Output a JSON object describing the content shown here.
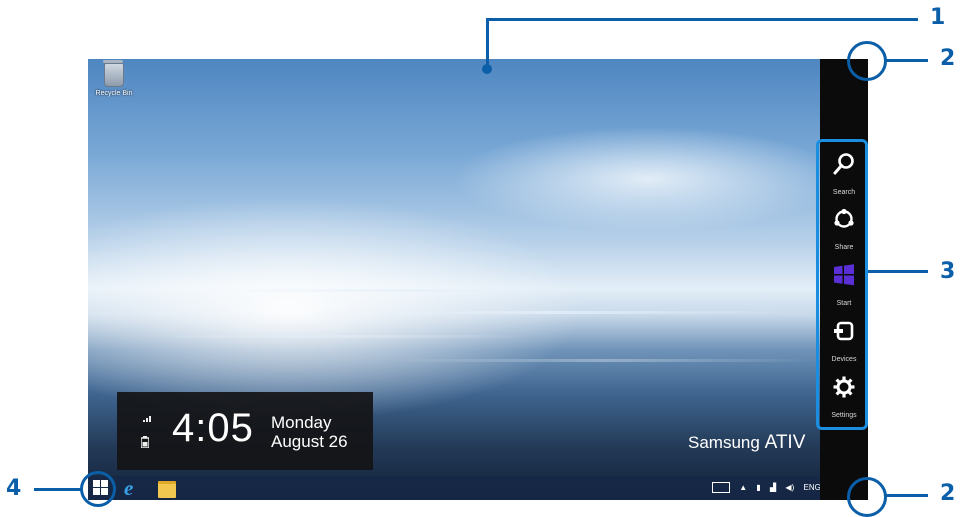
{
  "desktop": {
    "recycle_bin_label": "Recycle Bin",
    "brand_prefix": "Samsung",
    "brand_model": "ATIV"
  },
  "clock": {
    "time": "4:05",
    "day": "Monday",
    "date": "August 26",
    "signal_icon": "signal-icon",
    "battery_icon": "battery-icon"
  },
  "charms": {
    "items": [
      {
        "label": "Search",
        "icon": "search-icon"
      },
      {
        "label": "Share",
        "icon": "share-icon"
      },
      {
        "label": "Start",
        "icon": "windows-logo-icon"
      },
      {
        "label": "Devices",
        "icon": "devices-icon"
      },
      {
        "label": "Settings",
        "icon": "gear-icon"
      }
    ],
    "start_color": "#5b2fd6"
  },
  "taskbar": {
    "start_icon": "windows-logo-icon",
    "pinned": [
      "internet-explorer-icon",
      "file-explorer-icon"
    ],
    "tray_language": "ENG"
  },
  "callouts": {
    "one": "1",
    "two_top": "2",
    "two_bottom": "2",
    "three": "3",
    "four": "4",
    "color": "#0b5ea8"
  }
}
